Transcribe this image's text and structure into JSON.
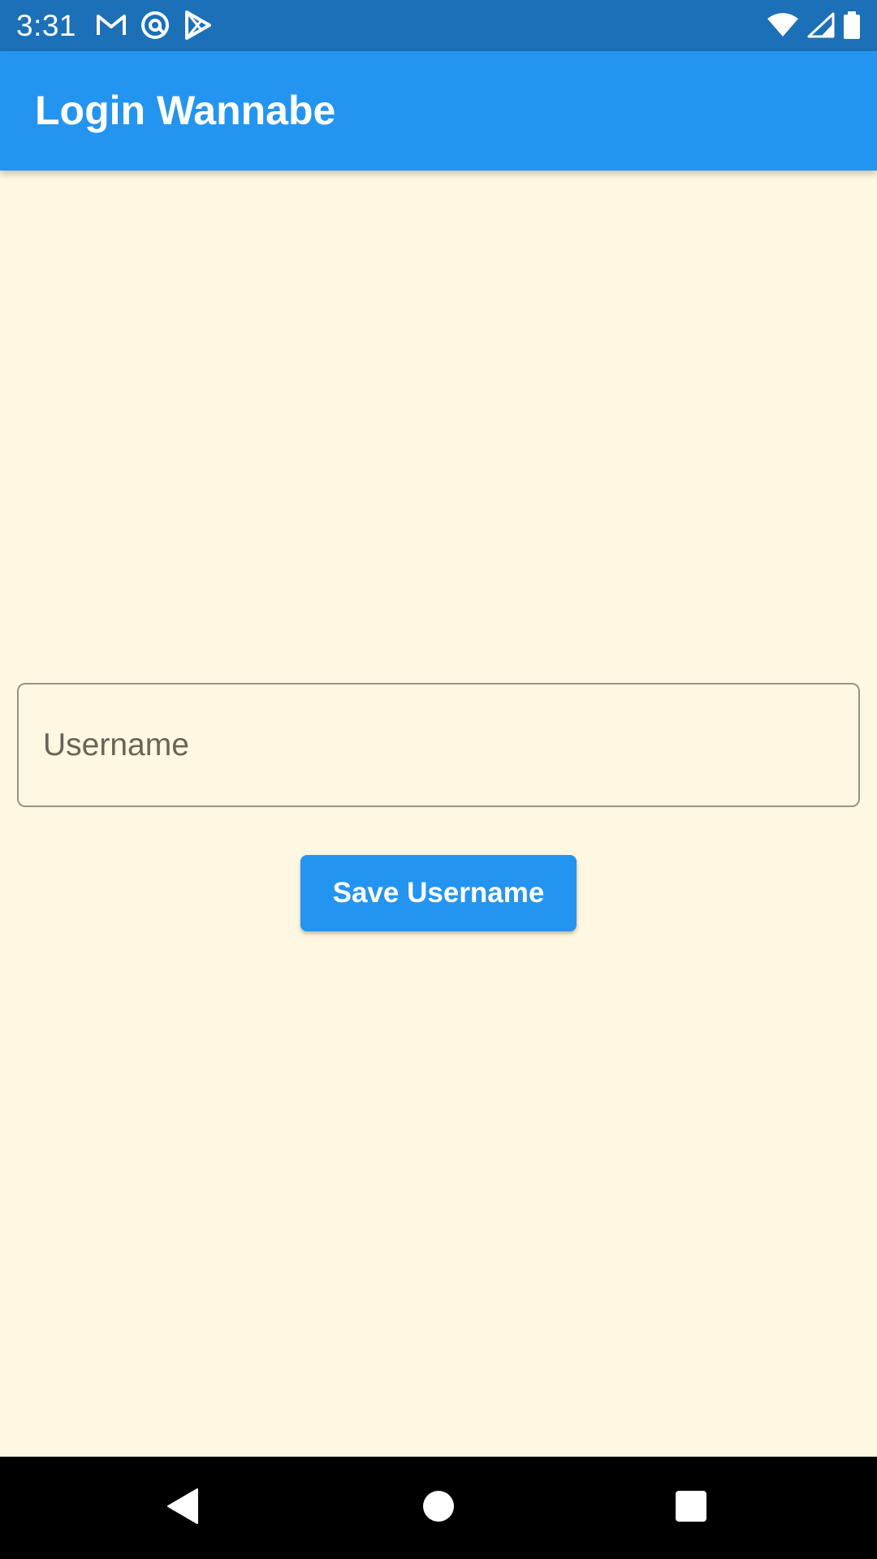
{
  "status_bar": {
    "time": "3:31",
    "left_icons": [
      "gmail-icon",
      "at-sign-icon",
      "play-store-icon"
    ],
    "right_icons": [
      "wifi-icon",
      "cell-signal-icon",
      "battery-icon"
    ],
    "background_color": "#1B70B7"
  },
  "app_bar": {
    "title": "Login Wannabe",
    "background_color": "#2395F1"
  },
  "form": {
    "username_field": {
      "placeholder": "Username",
      "value": ""
    },
    "save_button_label": "Save Username"
  },
  "nav_bar": {
    "buttons": [
      "back-icon",
      "home-icon",
      "recents-icon"
    ]
  },
  "colors": {
    "page_background": "#FEF7E1",
    "accent": "#2395F1",
    "field_border": "#9A9283"
  }
}
